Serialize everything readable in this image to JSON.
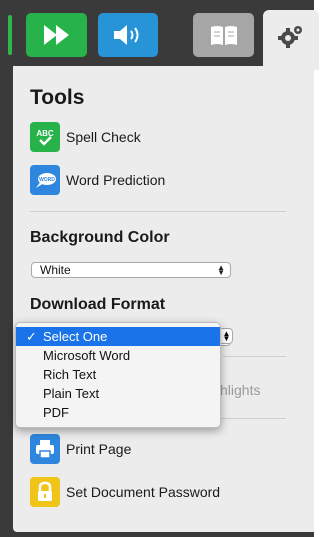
{
  "toolbar": {
    "buttons": [
      {
        "icon": "fast-forward-icon",
        "color": "#27b34a"
      },
      {
        "icon": "speaker-icon",
        "color": "#2694d6"
      },
      {
        "icon": "book-icon",
        "color": "#a6a6a6"
      },
      {
        "icon": "gear-icon",
        "selected": true
      }
    ]
  },
  "panel": {
    "tools_title": "Tools",
    "spell_check": {
      "label": "Spell Check",
      "icon_text": "ABC"
    },
    "word_prediction": {
      "label": "Word Prediction",
      "icon_text": "WORD"
    },
    "background_color": {
      "title": "Background Color",
      "value": "White"
    },
    "download_format": {
      "title": "Download Format",
      "selected": "Select One",
      "options": [
        "Select One",
        "Microsoft Word",
        "Rich Text",
        "Plain Text",
        "PDF"
      ]
    },
    "partially_hidden_label": "hlights",
    "print_page": {
      "label": "Print Page"
    },
    "set_password": {
      "label": "Set Document Password"
    }
  },
  "colors": {
    "accent_green": "#27b34a",
    "accent_blue": "#2e86de",
    "lock_yellow": "#f0c419",
    "selection_blue": "#1a73e8"
  }
}
